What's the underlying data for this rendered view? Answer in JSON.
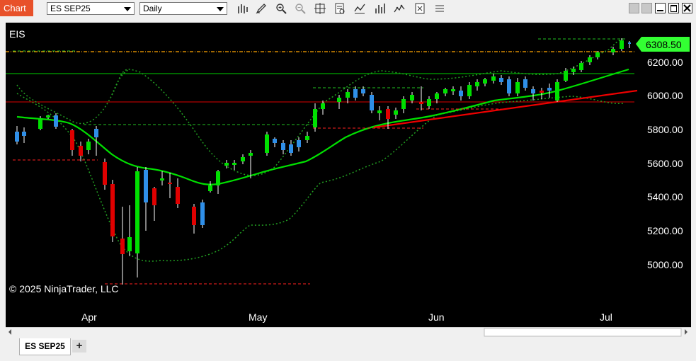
{
  "app": {
    "tab_label": "Chart"
  },
  "toolbar": {
    "instrument": "ES SEP25",
    "interval": "Daily",
    "tools": [
      "bar-type-icon",
      "draw-pencil-icon",
      "zoom-in-icon",
      "zoom-out-icon",
      "crosshair-icon",
      "data-box-icon",
      "indicators-icon",
      "strategies-icon",
      "properties-icon",
      "templates-icon"
    ]
  },
  "chart": {
    "symbol_label": "EIS",
    "copyright": "© 2025 NinjaTrader, LLC",
    "last_price": "6308.50",
    "price_axis": [
      "6200.00",
      "6000.00",
      "5800.00",
      "5600.00",
      "5400.00",
      "5200.00",
      "5000.00"
    ],
    "time_axis": [
      "Apr",
      "May",
      "Jun",
      "Jul"
    ],
    "colors": {
      "up_bar": "#00e000",
      "down_bar": "#e00000",
      "up_bar_alt": "#2f8fe8",
      "sma_fast": "#00e000",
      "sma_slow": "#ee0000",
      "bollinger": "#22a022",
      "last_price_badge": "#33ff33"
    }
  },
  "tabs": {
    "active": "ES SEP25",
    "add_label": "+"
  }
}
